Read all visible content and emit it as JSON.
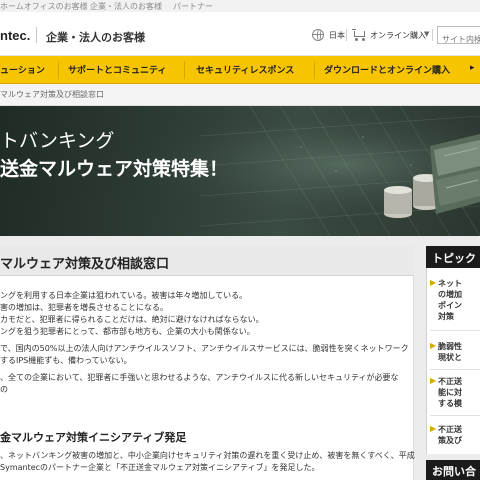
{
  "audience_bar": {
    "items": [
      "ホームオフィスのお客様",
      "企業・法人のお客様",
      "パートナー"
    ]
  },
  "header": {
    "logo_text": "ntec.",
    "title": "企業・法人のお客様",
    "language": "日本",
    "shop_label": "オンライン購入",
    "shop_arrow": "▼",
    "search_placeholder": "サイト内検索"
  },
  "nav": {
    "items": [
      "ューション",
      "サポートとコミュニティ",
      "セキュリティレスポンス",
      "ダウンロードとオンライン購入"
    ],
    "trailing_arrow": "▸"
  },
  "breadcrumb": "マルウェア対策及び相談窓口",
  "hero": {
    "line1": "トバンキング",
    "line2": "送金マルウェア対策特集！"
  },
  "main": {
    "title": "マルウェア対策及び相談窓口",
    "paragraphs": [
      "ングを利用する日本企業は狙われている。被害は年々増加している。",
      "害の増加は、犯罪者を増長させることになる。",
      "カモだと、犯罪者に得られることだけは、絶対に避けなければならない。",
      "ングを狙う犯罪者にとって、都市部も地方も、企業の大小も関係ない。",
      "で、国内の50%以上の法人向けアンチウイルスソフト、アンチウイルスサービスには、脆弱性を突くネットワーク",
      "するIPS機能ずも、備わっていない。",
      "、全ての企業において、犯罪者に手強いと思わせるような、アンチウイルスに代る新しいセキュリティが必要な",
      "金マルウェア対策イニシアティブ発足",
      "、ネットバンキング被害の増加と、中小企業向けセキュリティ対策の遅れを重く受け止め、被害を無くすべく、平成",
      "Symantecのパートナー企業と「不正送金マルウェア対策イニシアティブ」を発足した。"
    ],
    "subhead": "金マルウェア対策イニシアティブ発足"
  },
  "sidebar": {
    "heading": "トピック",
    "items": [
      {
        "arrow": "▶",
        "lines": [
          "ネット",
          "の増加",
          "ポイン",
          "対策"
        ]
      },
      {
        "arrow": "▶",
        "lines": [
          "脆弱性",
          "現状と"
        ]
      },
      {
        "arrow": "▶",
        "lines": [
          "不正送",
          "能に対",
          "する模"
        ]
      },
      {
        "arrow": "▶",
        "lines": [
          "不正送",
          "策及び"
        ]
      }
    ],
    "heading2": "お問い合"
  },
  "colors": {
    "nav_yellow": "#f6c400",
    "hero_dark": "#2d3c34",
    "sidebar_head": "#1b1b1b"
  }
}
